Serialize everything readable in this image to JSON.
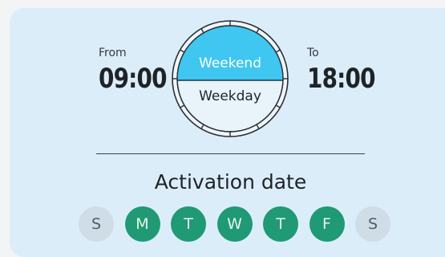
{
  "schedule": {
    "from_label": "From",
    "from_time": "09:00",
    "to_label": "To",
    "to_time": "18:00",
    "modes": {
      "weekend": "Weekend",
      "weekday": "Weekday"
    },
    "selected_mode": "Weekend",
    "colors": {
      "accent": "#3fc6f1",
      "active_day": "#1f9a74",
      "inactive_day": "#cfdde7",
      "card": "#dcedfa"
    }
  },
  "activation": {
    "title": "Activation date",
    "days": [
      {
        "label": "S",
        "active": false
      },
      {
        "label": "M",
        "active": true
      },
      {
        "label": "T",
        "active": true
      },
      {
        "label": "W",
        "active": true
      },
      {
        "label": "T",
        "active": true
      },
      {
        "label": "F",
        "active": true
      },
      {
        "label": "S",
        "active": false
      }
    ]
  }
}
